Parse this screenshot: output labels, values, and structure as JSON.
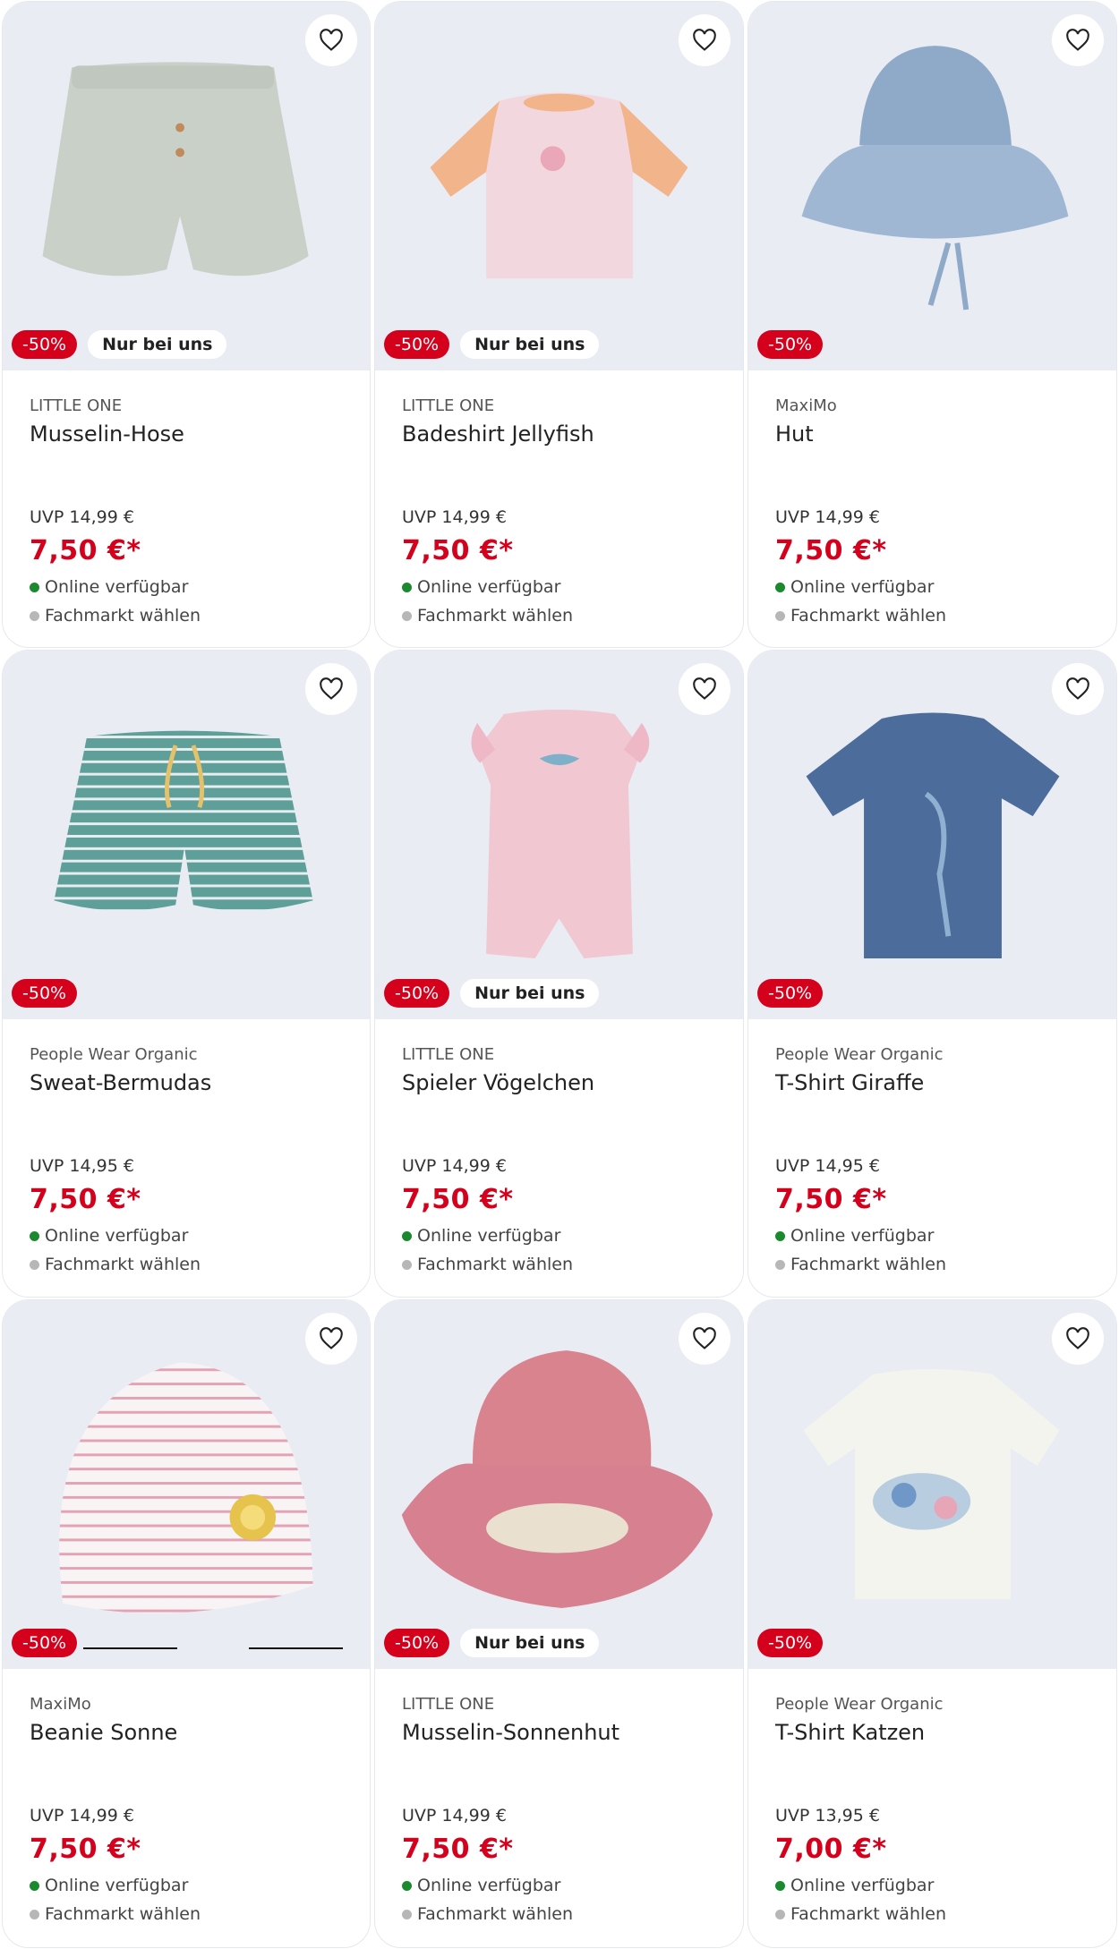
{
  "colors": {
    "sale": "#d5001c",
    "image_bg": "#e9ecf3",
    "available": "#1b8a2e",
    "store_dot": "#b7b7b7"
  },
  "icons": {
    "wishlist": "heart-outline-icon"
  },
  "products": [
    {
      "brand": "LITTLE ONE",
      "title": "Musselin-Hose",
      "discount": "-50%",
      "exclusive": "Nur bei uns",
      "uvp": "UVP 14,99 €",
      "price": "7,50 €*",
      "availability": "Online verfügbar",
      "store": "Fachmarkt wählen",
      "image": "muslin-shorts"
    },
    {
      "brand": "LITTLE ONE",
      "title": "Badeshirt Jellyfish",
      "discount": "-50%",
      "exclusive": "Nur bei uns",
      "uvp": "UVP 14,99 €",
      "price": "7,50 €*",
      "availability": "Online verfügbar",
      "store": "Fachmarkt wählen",
      "image": "swim-shirt"
    },
    {
      "brand": "MaxiMo",
      "title": "Hut",
      "discount": "-50%",
      "exclusive": "",
      "uvp": "UVP 14,99 €",
      "price": "7,50 €*",
      "availability": "Online verfügbar",
      "store": "Fachmarkt wählen",
      "image": "bucket-hat-blue"
    },
    {
      "brand": "People Wear Organic",
      "title": "Sweat-Bermudas",
      "discount": "-50%",
      "exclusive": "",
      "uvp": "UVP 14,95 €",
      "price": "7,50 €*",
      "availability": "Online verfügbar",
      "store": "Fachmarkt wählen",
      "image": "striped-shorts"
    },
    {
      "brand": "LITTLE ONE",
      "title": "Spieler Vögelchen",
      "discount": "-50%",
      "exclusive": "Nur bei uns",
      "uvp": "UVP 14,99 €",
      "price": "7,50 €*",
      "availability": "Online verfügbar",
      "store": "Fachmarkt wählen",
      "image": "pink-romper"
    },
    {
      "brand": "People Wear Organic",
      "title": "T-Shirt Giraffe",
      "discount": "-50%",
      "exclusive": "",
      "uvp": "UVP 14,95 €",
      "price": "7,50 €*",
      "availability": "Online verfügbar",
      "store": "Fachmarkt wählen",
      "image": "blue-tshirt"
    },
    {
      "brand": "MaxiMo",
      "title": "Beanie Sonne",
      "discount": "-50%",
      "exclusive": "",
      "uvp": "UVP 14,99 €",
      "price": "7,50 €*",
      "availability": "Online verfügbar",
      "store": "Fachmarkt wählen",
      "image": "striped-beanie"
    },
    {
      "brand": "LITTLE ONE",
      "title": "Musselin-Sonnenhut",
      "discount": "-50%",
      "exclusive": "Nur bei uns",
      "uvp": "UVP 14,99 €",
      "price": "7,50 €*",
      "availability": "Online verfügbar",
      "store": "Fachmarkt wählen",
      "image": "pink-sunhat"
    },
    {
      "brand": "People Wear Organic",
      "title": "T-Shirt Katzen",
      "discount": "-50%",
      "exclusive": "",
      "uvp": "UVP 13,95 €",
      "price": "7,00 €*",
      "availability": "Online verfügbar",
      "store": "Fachmarkt wählen",
      "image": "white-tshirt-cats"
    }
  ]
}
